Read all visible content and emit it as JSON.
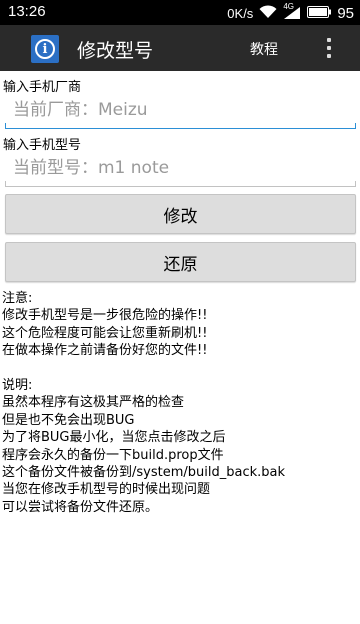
{
  "status_bar": {
    "time": "13:26",
    "network_speed": "0K/s",
    "network_type": "4G",
    "battery": "95"
  },
  "action_bar": {
    "title": "修改型号",
    "tutorial_label": "教程",
    "app_icon_glyph": "i"
  },
  "manufacturer": {
    "label": "输入手机厂商",
    "placeholder": "当前厂商：Meizu"
  },
  "model": {
    "label": "输入手机型号",
    "placeholder": "当前型号：m1 note"
  },
  "buttons": {
    "modify": "修改",
    "restore": "还原"
  },
  "notes": [
    "注意:",
    "修改手机型号是一步很危险的操作!!",
    "这个危险程度可能会让您重新刷机!!",
    "在做本操作之前请备份好您的文件!!",
    "",
    "说明:",
    "虽然本程序有这极其严格的检查",
    "但是也不免会出现BUG",
    "为了将BUG最小化，当您点击修改之后",
    "程序会永久的备份一下build.prop文件",
    "这个备份文件被备份到/system/build_back.bak",
    "当您在修改手机型号的时候出现问题",
    "可以尝试将备份文件还原。"
  ],
  "colors": {
    "accent": "#2b8fd6",
    "action_bar": "#2a2a2a",
    "button_bg": "#dddddd"
  }
}
